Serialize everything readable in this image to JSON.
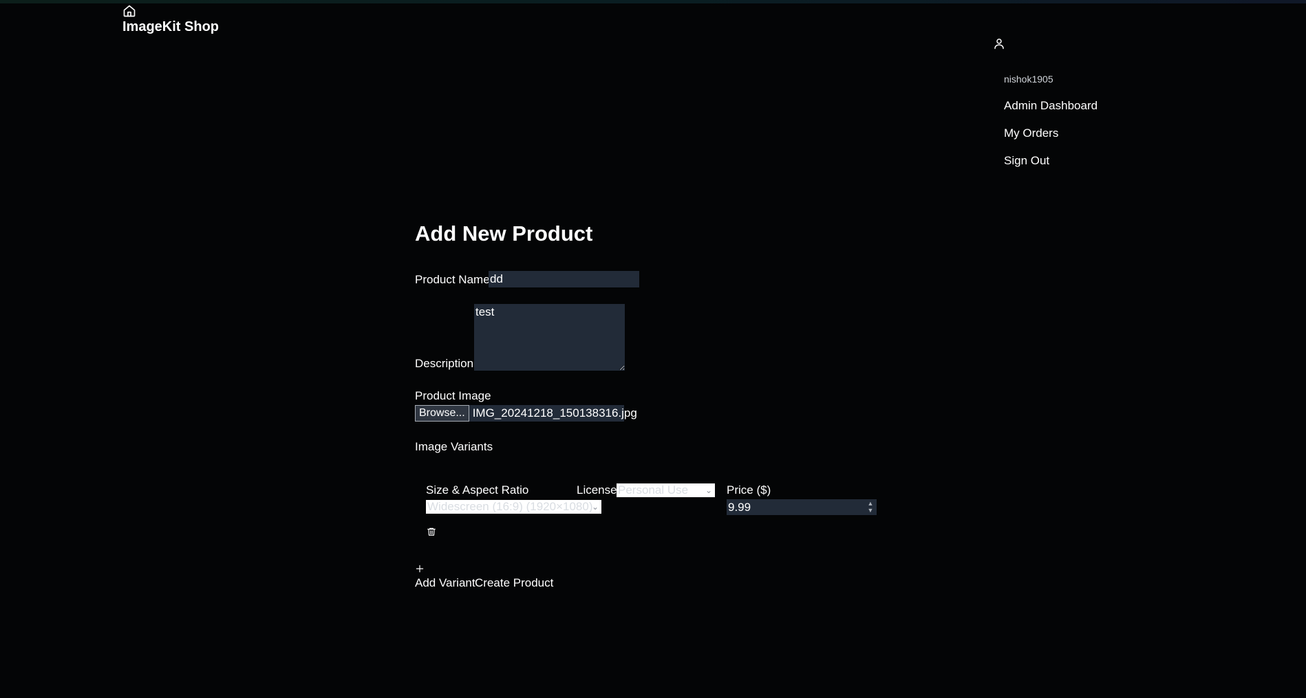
{
  "header": {
    "brand_title": "ImageKit Shop",
    "home_icon": "home-icon",
    "user_icon": "user-icon"
  },
  "user_menu": {
    "username": "nishok1905",
    "items": [
      {
        "label": "Admin Dashboard"
      },
      {
        "label": "My Orders"
      },
      {
        "label": "Sign Out"
      }
    ]
  },
  "form": {
    "title": "Add New Product",
    "product_name": {
      "label": "Product Name",
      "value": "dd"
    },
    "description": {
      "label": "Description",
      "value": "test"
    },
    "product_image": {
      "label": "Product Image",
      "browse_label": "Browse...",
      "file_name": "IMG_20241218_150138316.jpg"
    },
    "variants": {
      "label": "Image Variants",
      "columns": {
        "size": "Size & Aspect Ratio",
        "license": "License",
        "price": "Price ($)"
      },
      "rows": [
        {
          "size": "Widescreen (16:9) (1920×1080)",
          "license": "Personal Use",
          "price": "9.99",
          "delete_icon": "trash-icon"
        }
      ]
    },
    "add_variant_label": "Add Variant",
    "create_label": "Create Product"
  },
  "colors": {
    "background": "#040506",
    "field_background": "#222b38",
    "text": "#ffffff"
  }
}
